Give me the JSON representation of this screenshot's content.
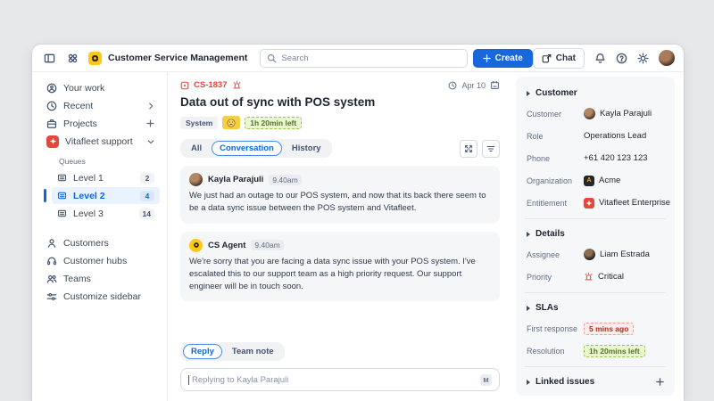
{
  "colors": {
    "accent_blue": "#1868db",
    "selected_blue": "#0c66e4",
    "critical_red": "#e2483d",
    "logo_yellow": "#ffc716",
    "sla_red_text": "#ae2a19",
    "sla_green_text": "#55712c"
  },
  "topbar": {
    "app_title": "Customer Service Management",
    "search_placeholder": "Search",
    "create_label": "Create",
    "chat_label": "Chat"
  },
  "sidebar": {
    "items": {
      "your_work": "Your work",
      "recent": "Recent",
      "projects": "Projects",
      "project_name": "Vitafleet support"
    },
    "queues_label": "Queues",
    "queues": [
      {
        "label": "Level 1",
        "count": "2"
      },
      {
        "label": "Level 2",
        "count": "4"
      },
      {
        "label": "Level 3",
        "count": "14"
      }
    ],
    "footer": [
      {
        "label": "Customers"
      },
      {
        "label": "Customer hubs"
      },
      {
        "label": "Teams"
      },
      {
        "label": "Customize sidebar"
      }
    ]
  },
  "ticket": {
    "key": "CS-1837",
    "date": "Apr 10",
    "title": "Data out of sync with POS system",
    "tags": {
      "system": "System",
      "emoji": "smiley-reaction",
      "sla": "1h 20min left"
    },
    "tabs": [
      {
        "label": "All"
      },
      {
        "label": "Conversation"
      },
      {
        "label": "History"
      }
    ],
    "active_tab": "Conversation"
  },
  "messages": [
    {
      "author": "Kayla Parajuli",
      "time": "9.40am",
      "text": "We just had an outage to our POS system, and now that its back there seem to be a data sync issue between the POS system and Vitafleet."
    },
    {
      "author": "CS Agent",
      "time": "9.40am",
      "text": "We're sorry that you are facing a data sync issue with your POS system. I've escalated this to our support team as a high priority request. Our support engineer will be in touch soon."
    }
  ],
  "reply": {
    "tabs": [
      {
        "label": "Reply"
      },
      {
        "label": "Team note"
      }
    ],
    "active_tab": "Reply",
    "placeholder": "Replying to Kayla Parajuli",
    "markdown_badge": "M"
  },
  "panel": {
    "customer": {
      "title": "Customer",
      "rows": [
        {
          "label": "Customer",
          "value": "Kayla Parajuli"
        },
        {
          "label": "Role",
          "value": "Operations Lead"
        },
        {
          "label": "Phone",
          "value": "+61 420 123 123"
        },
        {
          "label": "Organization",
          "value": "Acme"
        },
        {
          "label": "Entitlement",
          "value": "Vitafleet Enterprise"
        }
      ],
      "org_initial": "A"
    },
    "details": {
      "title": "Details",
      "assignee_label": "Assignee",
      "assignee_value": "Liam Estrada",
      "priority_label": "Priority",
      "priority_value": "Critical"
    },
    "slas": {
      "title": "SLAs",
      "first_response_label": "First response",
      "first_response_value": "5 mins ago",
      "resolution_label": "Resolution",
      "resolution_value": "1h 20mins left"
    },
    "linked_issues": {
      "title": "Linked issues"
    }
  }
}
